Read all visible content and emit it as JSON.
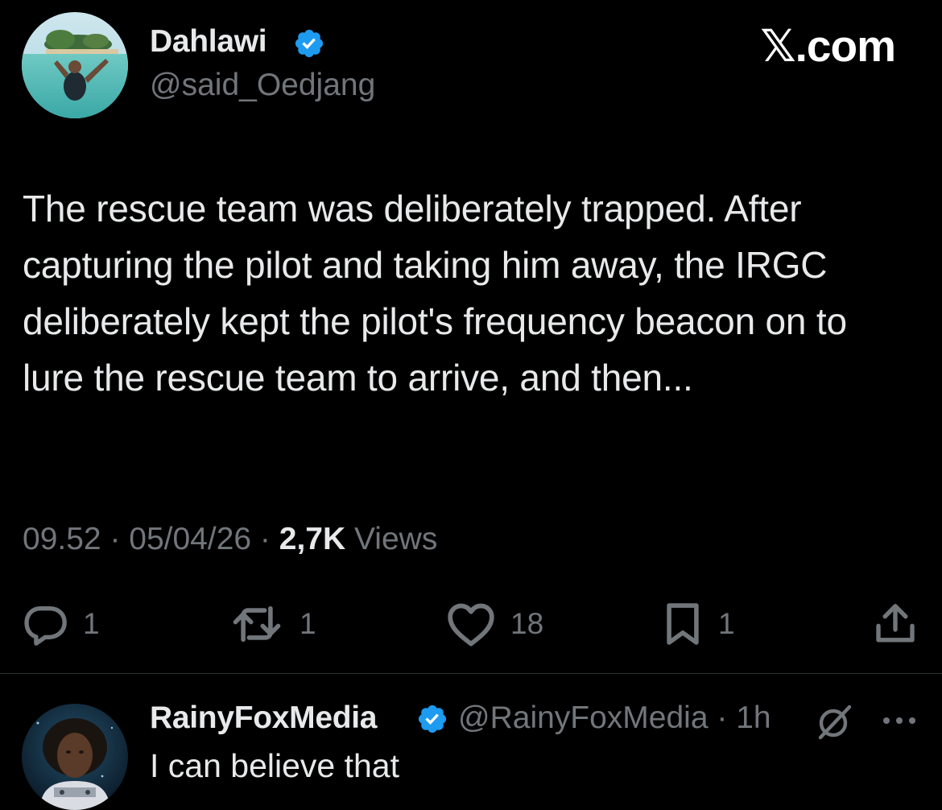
{
  "tweet": {
    "author": {
      "display_name": "Dahlawi",
      "handle": "@said_Oedjang",
      "verified": true
    },
    "site_mark": "𝕏.com",
    "text": "The rescue team was deliberately trapped. After capturing the pilot and taking him away, the IRGC deliberately kept the pilot's frequency beacon on to lure the rescue team to arrive, and then...",
    "meta": {
      "time": "09.52",
      "separator": " · ",
      "date": "05/04/26",
      "views_count": "2,7K",
      "views_label": " Views"
    },
    "actions": {
      "reply_count": "1",
      "retweet_count": "1",
      "like_count": "18",
      "bookmark_count": "1"
    }
  },
  "reply": {
    "display_name": "RainyFoxMedia",
    "verified": true,
    "handle_time": "@RainyFoxMedia · 1h",
    "text": "I can believe that"
  },
  "colors": {
    "background": "#000000",
    "primary_text": "#e7e9ea",
    "secondary_text": "#71767b",
    "verified_blue": "#1d9bf0",
    "divider": "#2f3336"
  },
  "icons": {
    "verified": "verified-badge-icon",
    "reply": "reply-icon",
    "retweet": "retweet-icon",
    "like": "heart-icon",
    "bookmark": "bookmark-icon",
    "share": "share-icon",
    "grok": "grok-icon",
    "more": "more-icon"
  }
}
